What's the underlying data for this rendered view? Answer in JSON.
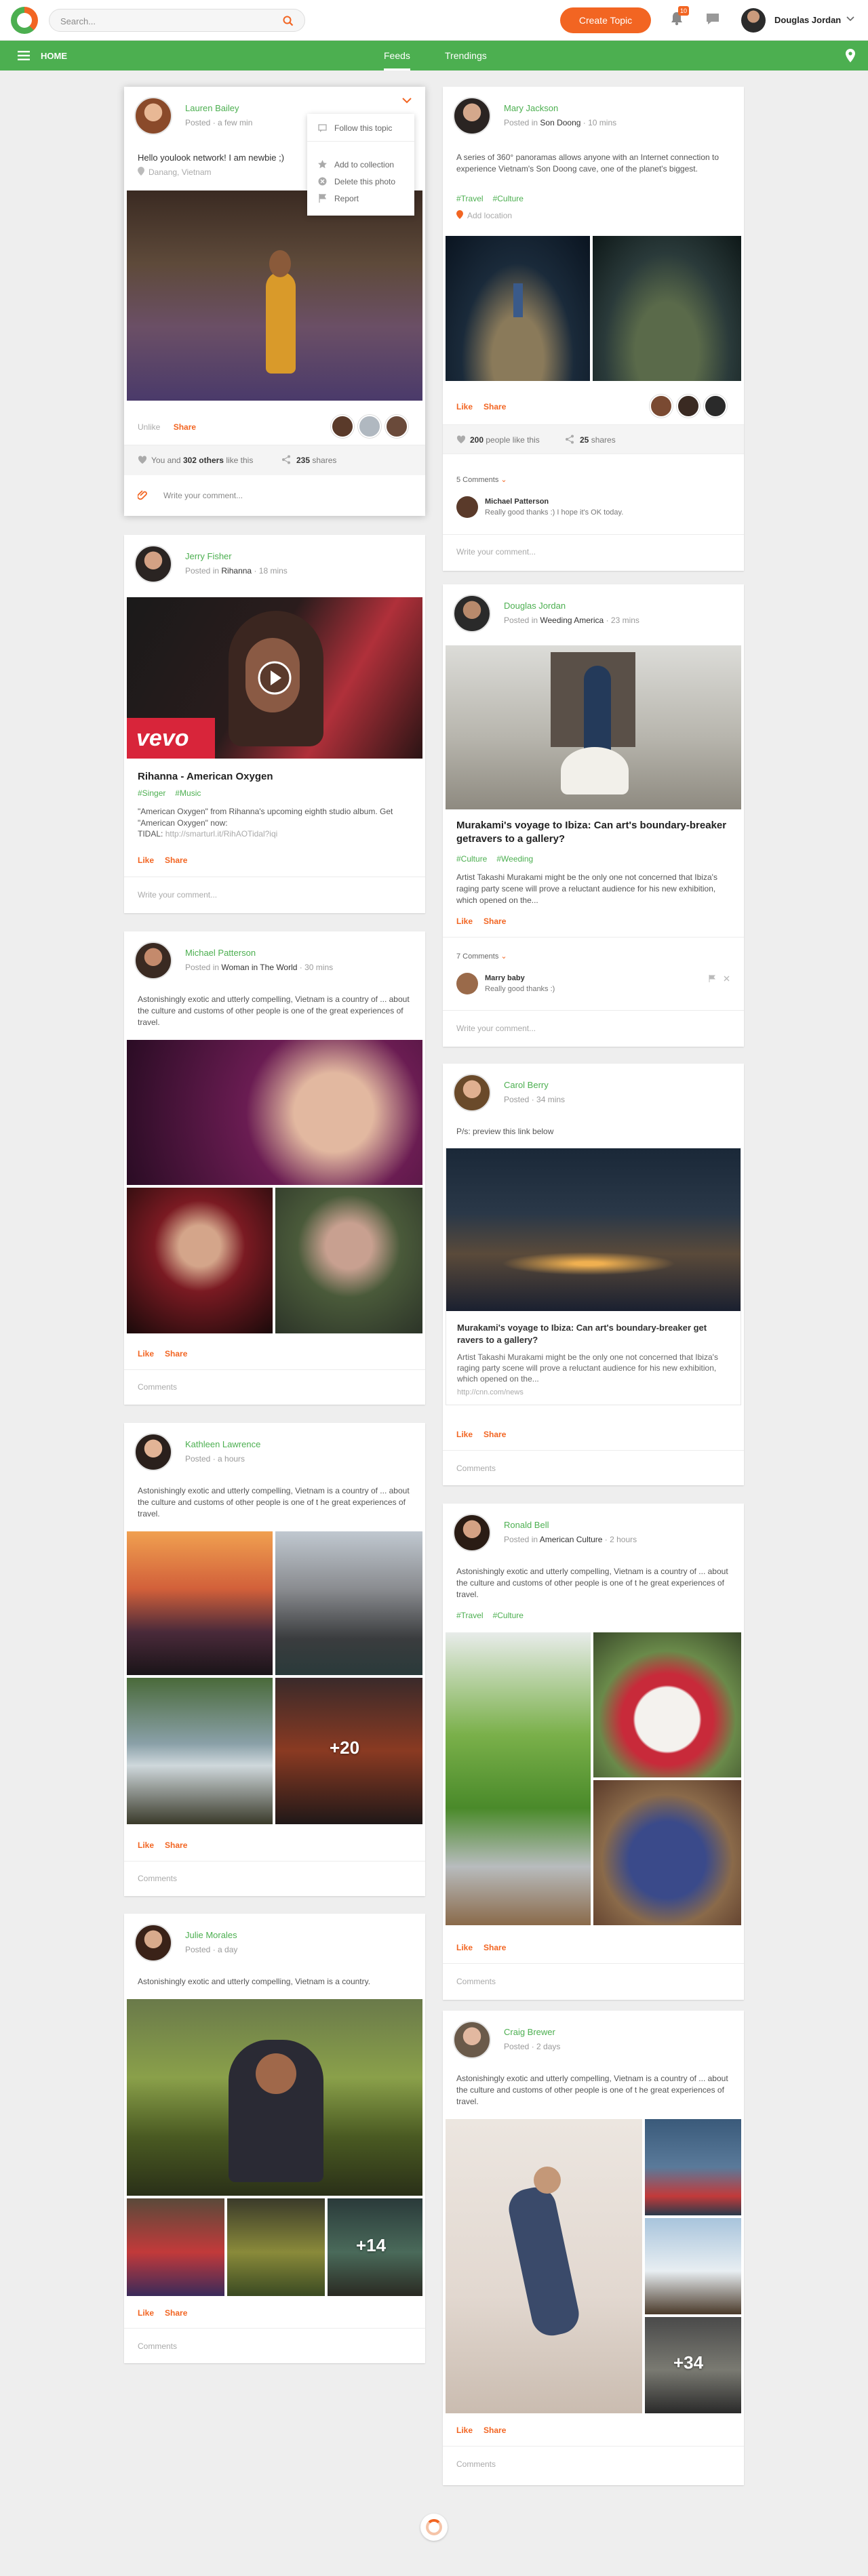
{
  "topbar": {
    "search_placeholder": "Search...",
    "create_label": "Create Topic",
    "notif_count": "10",
    "user_name": "Douglas Jordan"
  },
  "nav": {
    "home": "HOME",
    "tabs": [
      "Feeds",
      "Trendings"
    ]
  },
  "menu": {
    "items": [
      "Follow this topic",
      "Add to collection",
      "Delete this photo",
      "Report"
    ]
  },
  "posts": {
    "lauren": {
      "name": "Lauren Bailey",
      "meta": "Posted · a few min",
      "text": "Hello youlook network! I am newbie ;)",
      "location": "Danang, Vietnam",
      "unlike": "Unlike",
      "share": "Share",
      "likes_pre": "You and",
      "likes_bold": "302 others",
      "likes_post": "like this",
      "shares_count": "235",
      "shares_word": "shares",
      "comment_ph": "Write your comment..."
    },
    "jerry": {
      "name": "Jerry Fisher",
      "meta_pre": "Posted in",
      "meta_place": "Rihanna",
      "meta_time": "· 18 mins",
      "brand": "vevo",
      "title": "Rihanna - American Oxygen",
      "tags": [
        "#Singer",
        "#Music"
      ],
      "text": "\"American Oxygen\" from Rihanna's upcoming eighth studio album. Get \"American Oxygen\" now:",
      "tidal_label": "TIDAL:",
      "tidal_url": "http://smarturl.it/RihAOTidal?iqi",
      "like": "Like",
      "share": "Share",
      "comment_ph": "Write your comment..."
    },
    "michael": {
      "name": "Michael Patterson",
      "meta_pre": "Posted in",
      "meta_place": "Woman in The World",
      "meta_time": "· 30 mins",
      "text": "Astonishingly exotic and utterly compelling, Vietnam is a country of ... about the culture and customs of other people is one of the great experiences of travel.",
      "like": "Like",
      "share": "Share",
      "comments": "Comments"
    },
    "kathleen": {
      "name": "Kathleen Lawrence",
      "meta": "Posted · a hours",
      "text": "Astonishingly exotic and utterly compelling, Vietnam is a country of ... about the culture and customs of other people is one of t he great experiences of travel.",
      "more": "+20",
      "like": "Like",
      "share": "Share",
      "comments": "Comments"
    },
    "julie": {
      "name": "Julie Morales",
      "meta": "Posted · a day",
      "text": "Astonishingly exotic and utterly compelling, Vietnam is a country.",
      "more": "+14",
      "like": "Like",
      "share": "Share",
      "comments": "Comments"
    },
    "mary": {
      "name": "Mary Jackson",
      "meta_pre": "Posted in",
      "meta_place": "Son Doong",
      "meta_time": "· 10 mins",
      "text": "A series of 360° panoramas allows anyone with an Internet connection to experience Vietnam's Son Doong cave, one of the planet's biggest.",
      "tags": [
        "#Travel",
        "#Culture"
      ],
      "add_location": "Add location",
      "like": "Like",
      "share": "Share",
      "likes_count": "200",
      "likes_post": "people like this",
      "shares_count": "25",
      "shares_word": "shares",
      "comments_count": "5 Comments",
      "c_name": "Michael Patterson",
      "c_text": "Really good thanks :) I hope it's OK today.",
      "comment_ph": "Write your comment..."
    },
    "douglas": {
      "name": "Douglas Jordan",
      "meta_pre": "Posted in",
      "meta_place": "Weeding America",
      "meta_time": "· 23 mins",
      "title": "Murakami's voyage to Ibiza: Can art's boundary-breaker getravers to a gallery?",
      "tags": [
        "#Culture",
        "#Weeding"
      ],
      "text": "Artist Takashi Murakami might be the only one not concerned that Ibiza's raging party scene will prove a reluctant audience for his new exhibition, which opened on the...",
      "like": "Like",
      "share": "Share",
      "comments_count": "7 Comments",
      "c_name": "Marry baby",
      "c_text": "Really good thanks :)",
      "comment_ph": "Write your comment..."
    },
    "carol": {
      "name": "Carol Berry",
      "meta": "Posted · 34 mins",
      "text": "P/s: preview this link below",
      "link_title": "Murakami's voyage to Ibiza: Can art's boundary-breaker get ravers to a gallery?",
      "link_text": "Artist Takashi Murakami might be the only one not concerned that Ibiza's raging party scene will prove a reluctant audience for his new exhibition, which opened on the...",
      "link_url": "http://cnn.com/news",
      "like": "Like",
      "share": "Share",
      "comments": "Comments"
    },
    "ronald": {
      "name": "Ronald Bell",
      "meta_pre": "Posted in",
      "meta_place": "American Culture",
      "meta_time": "· 2 hours",
      "text": "Astonishingly exotic and utterly compelling, Vietnam is a country of ... about the culture and customs of other people is one of t he great experiences of travel.",
      "tags": [
        "#Travel",
        "#Culture"
      ],
      "like": "Like",
      "share": "Share",
      "comments": "Comments"
    },
    "craig": {
      "name": "Craig Brewer",
      "meta": "Posted · 2 days",
      "text": "Astonishingly exotic and utterly compelling, Vietnam is a country of ... about the culture and customs of other people is one of t he great experiences of travel.",
      "more": "+34",
      "like": "Like",
      "share": "Share",
      "comments": "Comments"
    }
  },
  "colors": {
    "accent": "#f26522",
    "green": "#4caf50",
    "background": "#eeeeee"
  }
}
